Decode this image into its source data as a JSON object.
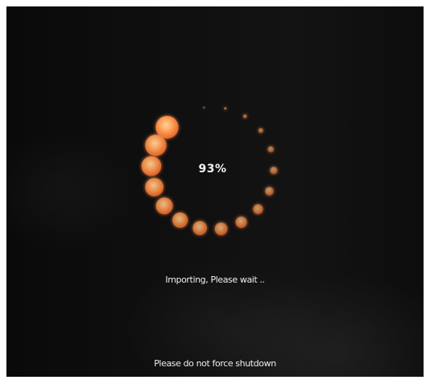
{
  "progress": {
    "percent_label": "93%",
    "value": 0.93,
    "dot_count": 17,
    "dot_color": "#ff9a4d"
  },
  "status_text": "Importing, Please wait ..",
  "warning_text": "Please do not force shutdown",
  "colors": {
    "background": "#0c0c0c",
    "accent": "#ff9a4d",
    "text": "#f0f0f0"
  }
}
